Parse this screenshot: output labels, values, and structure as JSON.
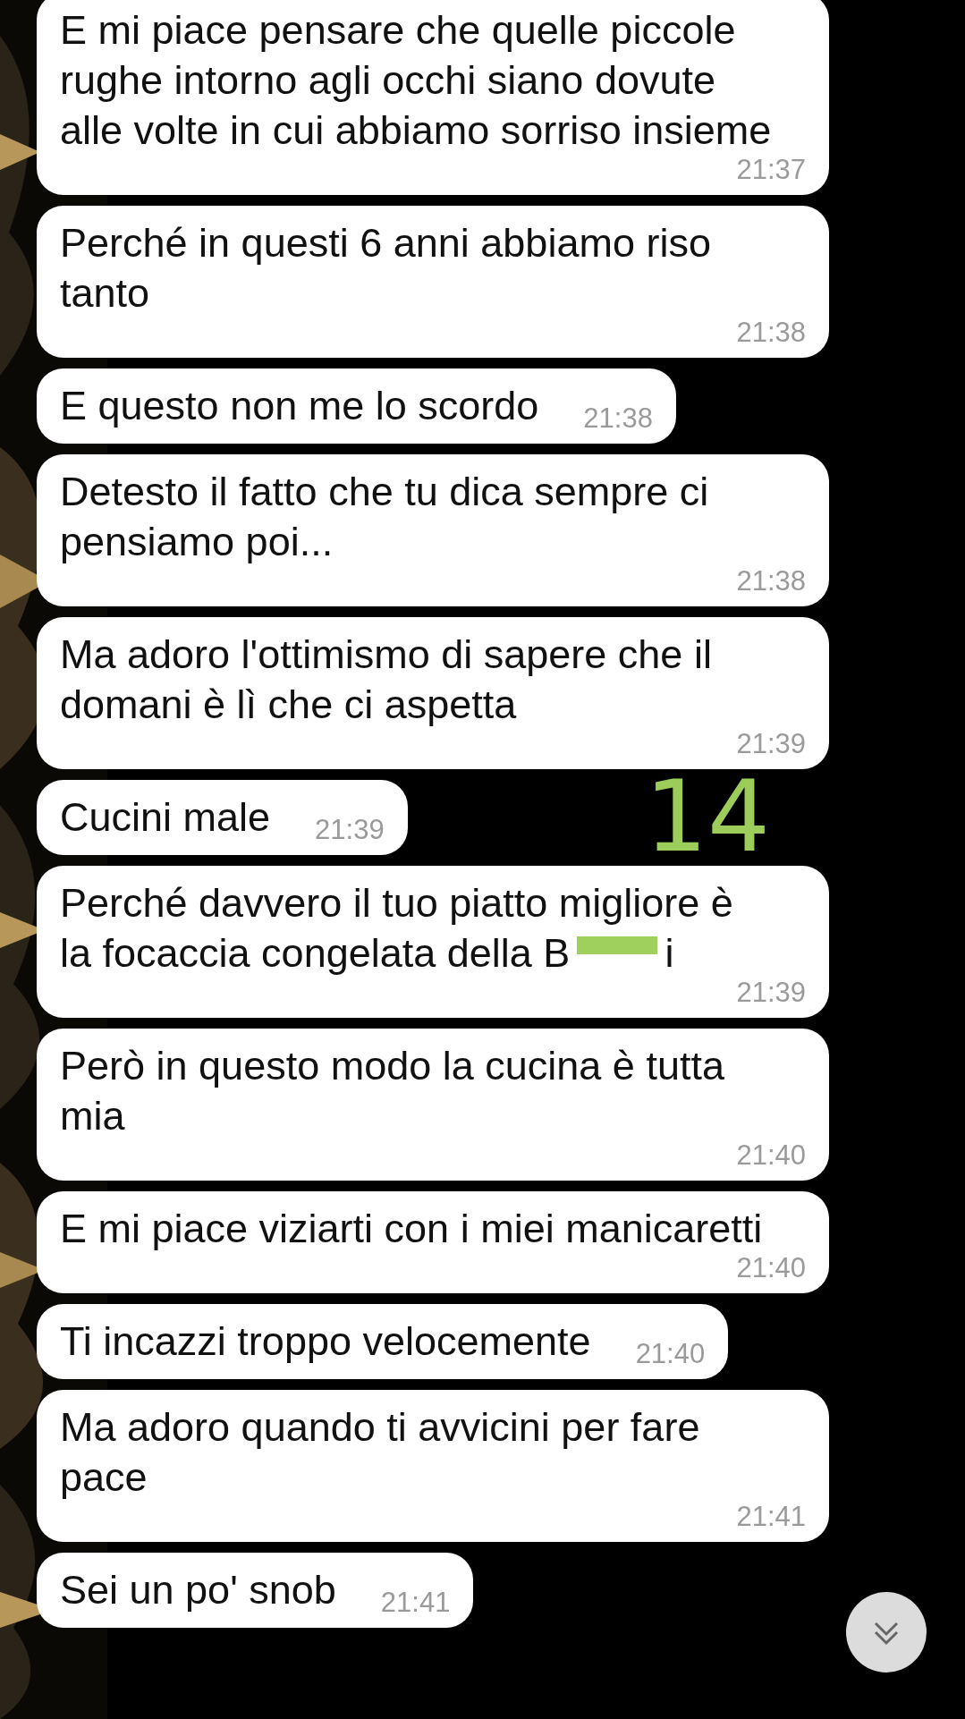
{
  "messages": [
    {
      "text": "E mi piace pensare che quelle piccole rughe intorno agli occhi siano dovute alle volte in cui abbiamo sorriso insieme",
      "time": "21:37"
    },
    {
      "text": "Perché in questi 6 anni abbiamo riso tanto",
      "time": "21:38"
    },
    {
      "text": "E questo non me lo scordo",
      "time": "21:38"
    },
    {
      "text": "Detesto il fatto che tu dica sempre ci pensiamo poi...",
      "time": "21:38"
    },
    {
      "text": "Ma adoro l'ottimismo di sapere che il domani è lì che ci aspetta",
      "time": "21:39"
    },
    {
      "text": "Cucini male",
      "time": "21:39",
      "annotation": "14"
    },
    {
      "text": "Perché davvero il tuo piatto migliore è la focaccia congelata della B",
      "redacted": true,
      "text_after": "i",
      "time": "21:39"
    },
    {
      "text": "Però in questo modo la cucina è tutta mia",
      "time": "21:40"
    },
    {
      "text": "E mi piace viziarti con i miei manicaretti",
      "time": "21:40"
    },
    {
      "text": "Ti incazzi troppo velocemente",
      "time": "21:40"
    },
    {
      "text": "Ma adoro quando ti avvicini per fare pace",
      "time": "21:41"
    },
    {
      "text": "Sei un po' snob",
      "time": "21:41"
    }
  ]
}
